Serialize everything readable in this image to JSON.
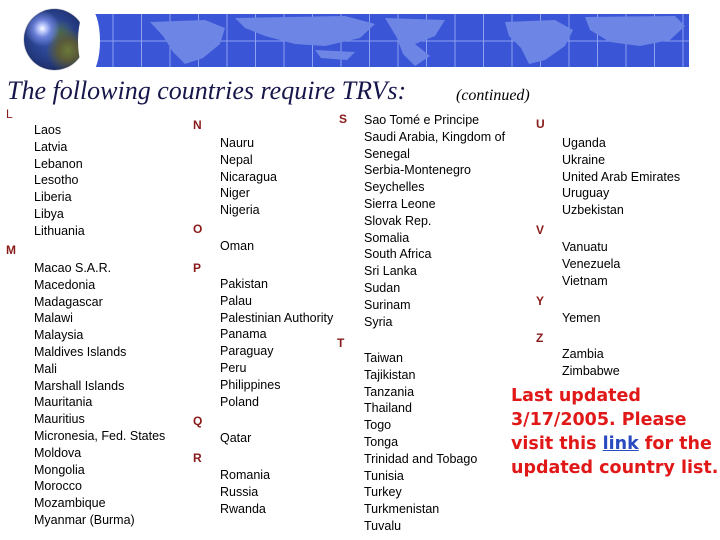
{
  "header": {
    "globe_icon": "globe-icon",
    "banner": "world-map-banner",
    "title": "The following countries require TRVs:",
    "subtitle": "(continued)"
  },
  "groups": {
    "L": {
      "letter": "L",
      "countries": [
        "Laos",
        "Latvia",
        "Lebanon",
        "Lesotho",
        "Liberia",
        "Libya",
        "Lithuania"
      ]
    },
    "M": {
      "letter": "M",
      "countries": [
        "Macao S.A.R.",
        "Macedonia",
        "Madagascar",
        "Malawi",
        "Malaysia",
        "Maldives Islands",
        "Mali",
        "Marshall Islands",
        "Mauritania",
        "Mauritius",
        "Micronesia, Fed. States",
        "Moldova",
        "Mongolia",
        "Morocco",
        "Mozambique",
        "Myanmar (Burma)"
      ]
    },
    "N": {
      "letter": "N",
      "countries": [
        "Nauru",
        "Nepal",
        "Nicaragua",
        "Niger",
        "Nigeria"
      ]
    },
    "O": {
      "letter": "O",
      "countries": [
        "Oman"
      ]
    },
    "P": {
      "letter": "P",
      "countries": [
        "Pakistan",
        "Palau",
        "Palestinian Authority",
        "Panama",
        "Paraguay",
        "Peru",
        "Philippines",
        "Poland"
      ]
    },
    "Q": {
      "letter": "Q",
      "countries": [
        "Qatar"
      ]
    },
    "R": {
      "letter": "R",
      "countries": [
        "Romania",
        "Russia",
        "Rwanda"
      ]
    },
    "S": {
      "letter": "S",
      "countries": [
        "Sao Tomé e Principe",
        "Saudi Arabia, Kingdom of",
        "Senegal",
        "Serbia-Montenegro",
        "Seychelles",
        "Sierra Leone",
        "Slovak Rep.",
        "Somalia",
        "South Africa",
        "Sri Lanka",
        "Sudan",
        "Surinam",
        "Syria"
      ]
    },
    "T": {
      "letter": "T",
      "countries": [
        "Taiwan",
        "Tajikistan",
        "Tanzania",
        "Thailand",
        "Togo",
        "Tonga",
        "Trinidad and Tobago",
        "Tunisia",
        "Turkey",
        "Turkmenistan",
        "Tuvalu"
      ]
    },
    "U": {
      "letter": "U",
      "countries": [
        "Uganda",
        "Ukraine",
        "United Arab Emirates",
        "Uruguay",
        "Uzbekistan"
      ]
    },
    "V": {
      "letter": "V",
      "countries": [
        "Vanuatu",
        "Venezuela",
        "Vietnam"
      ]
    },
    "Y": {
      "letter": "Y",
      "countries": [
        "Yemen"
      ]
    },
    "Z": {
      "letter": "Z",
      "countries": [
        "Zambia",
        "Zimbabwe"
      ]
    }
  },
  "notice": {
    "line1": "Last updated",
    "line2": "3/17/2005. Please",
    "line3_before": "visit this ",
    "link_text": "link",
    "line3_after": " for the",
    "line4": "updated country list."
  },
  "colors": {
    "banner": "#3a55d6",
    "letter_heading": "#8a1a1a",
    "notice": "#e01818",
    "link": "#2a4ac0",
    "title": "#16164a"
  }
}
